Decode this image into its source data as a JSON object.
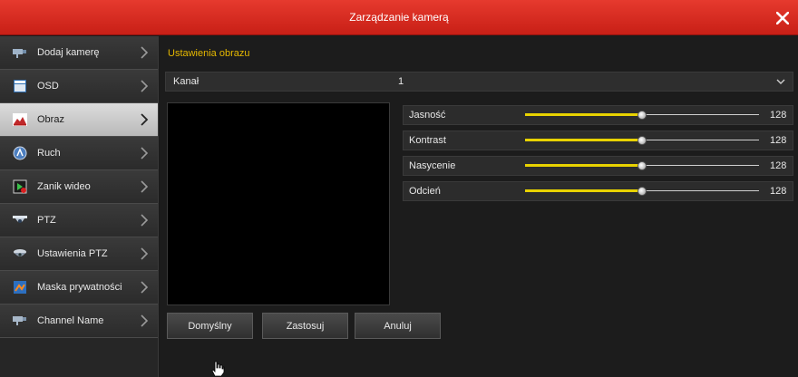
{
  "window": {
    "title": "Zarządzanie kamerą"
  },
  "sidebar": {
    "items": [
      {
        "label": "Dodaj kamerę",
        "icon": "add-camera-icon"
      },
      {
        "label": "OSD",
        "icon": "osd-icon"
      },
      {
        "label": "Obraz",
        "icon": "image-icon",
        "active": true
      },
      {
        "label": "Ruch",
        "icon": "motion-icon"
      },
      {
        "label": "Zanik wideo",
        "icon": "video-loss-icon"
      },
      {
        "label": "PTZ",
        "icon": "ptz-icon"
      },
      {
        "label": "Ustawienia PTZ",
        "icon": "ptz-settings-icon"
      },
      {
        "label": "Maska prywatności",
        "icon": "privacy-mask-icon"
      },
      {
        "label": "Channel Name",
        "icon": "channel-name-icon"
      }
    ]
  },
  "main": {
    "section_title": "Ustawienia obrazu",
    "channel": {
      "label": "Kanał",
      "value": "1"
    },
    "sliders": [
      {
        "label": "Jasność",
        "value": "128",
        "level": 0.5
      },
      {
        "label": "Kontrast",
        "value": "128",
        "level": 0.5
      },
      {
        "label": "Nasycenie",
        "value": "128",
        "level": 0.5
      },
      {
        "label": "Odcień",
        "value": "128",
        "level": 0.5
      }
    ],
    "buttons": {
      "default_label": "Domyślny",
      "apply_label": "Zastosuj",
      "cancel_label": "Anuluj"
    }
  },
  "colors": {
    "title_bar": "#d8281e",
    "section_title": "#e6b800",
    "slider_fill": "#e8d200"
  }
}
